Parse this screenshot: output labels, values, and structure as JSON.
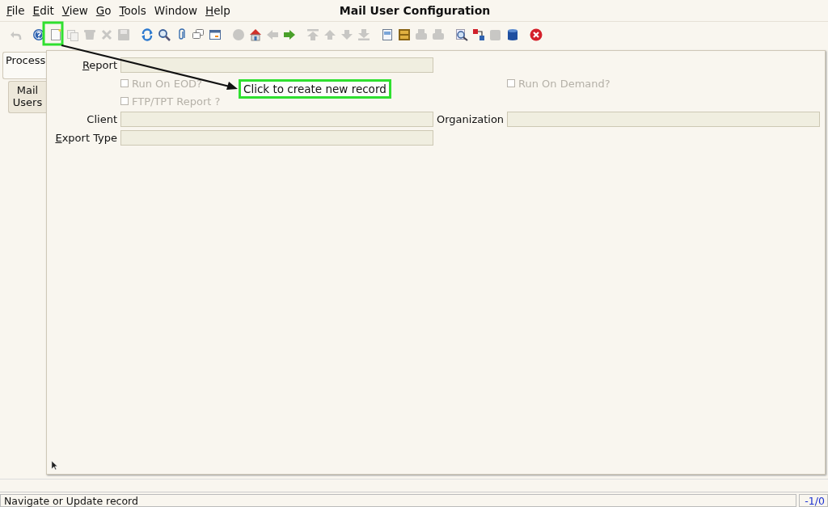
{
  "window": {
    "title": "Mail User Configuration"
  },
  "menu": [
    {
      "label": "File",
      "first_letter_underlined": true
    },
    {
      "label": "Edit",
      "first_letter_underlined": true
    },
    {
      "label": "View",
      "first_letter_underlined": true
    },
    {
      "label": "Go",
      "first_letter_underlined": true
    },
    {
      "label": "Tools",
      "first_letter_underlined": true
    },
    {
      "label": "Window",
      "first_letter_underlined": false
    },
    {
      "label": "Help",
      "first_letter_underlined": true
    }
  ],
  "toolbar": [
    {
      "disabled": true
    },
    {
      "disabled": false
    },
    {
      "disabled": false
    },
    {
      "disabled": true
    },
    {
      "disabled": true
    },
    {
      "disabled": true
    },
    {
      "disabled": true
    },
    {
      "disabled": false
    },
    {
      "disabled": false
    },
    {
      "disabled": false
    },
    {
      "disabled": false
    },
    {
      "disabled": false
    },
    {
      "disabled": true
    },
    {
      "disabled": false
    },
    {
      "disabled": true
    },
    {
      "disabled": false
    },
    {
      "disabled": true
    },
    {
      "disabled": true
    },
    {
      "disabled": true
    },
    {
      "disabled": true
    },
    {
      "disabled": false
    },
    {
      "disabled": false
    },
    {
      "disabled": true
    },
    {
      "disabled": true
    },
    {
      "disabled": false
    },
    {
      "disabled": false
    },
    {
      "disabled": true
    },
    {
      "disabled": false
    },
    {
      "disabled": false
    }
  ],
  "tabs": [
    {
      "label": "Process",
      "selected": true
    },
    {
      "label": "Mail Users",
      "selected": false
    }
  ],
  "form": {
    "report": {
      "label": "Report",
      "first_letter_underlined": true
    },
    "checkboxes": [
      {
        "label": "Run On EOD?",
        "checked": false,
        "disabled": true
      },
      {
        "label": "Run On Demand?",
        "checked": false,
        "disabled": true
      },
      {
        "label": "FTP/TPT Report ?",
        "checked": false,
        "disabled": true
      }
    ],
    "client": {
      "label": "Client"
    },
    "organization": {
      "label": "Organization"
    },
    "export_type": {
      "label": "Export Type",
      "first_letter_underlined": true
    }
  },
  "callout": {
    "text": "Click to create new record"
  },
  "status_bar": {
    "message": "Navigate or Update record",
    "record": "-1/0"
  }
}
